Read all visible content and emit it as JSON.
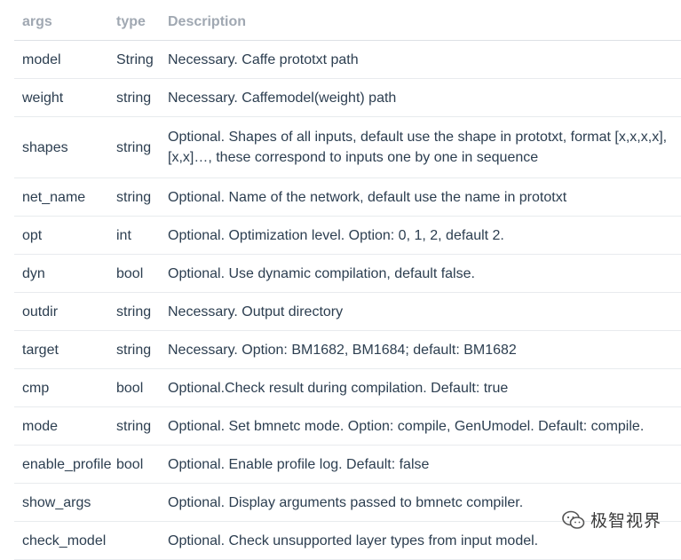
{
  "columns": {
    "args": "args",
    "type": "type",
    "description": "Description"
  },
  "rows": [
    {
      "args": "model",
      "type": "String",
      "description": "Necessary. Caffe prototxt path"
    },
    {
      "args": "weight",
      "type": "string",
      "description": "Necessary. Caffemodel(weight) path"
    },
    {
      "args": "shapes",
      "type": "string",
      "description": "Optional. Shapes of all inputs, default use the shape in prototxt, format [x,x,x,x],[x,x]…, these correspond to inputs one by one in sequence"
    },
    {
      "args": "net_name",
      "type": "string",
      "description": "Optional. Name of the network, default use the name in prototxt"
    },
    {
      "args": "opt",
      "type": "int",
      "description": "Optional. Optimization level. Option: 0, 1, 2, default 2."
    },
    {
      "args": "dyn",
      "type": "bool",
      "description": "Optional. Use dynamic compilation, default false."
    },
    {
      "args": "outdir",
      "type": "string",
      "description": "Necessary. Output directory"
    },
    {
      "args": "target",
      "type": "string",
      "description": "Necessary. Option: BM1682, BM1684; default: BM1682"
    },
    {
      "args": "cmp",
      "type": "bool",
      "description": "Optional.Check result during compilation. Default: true"
    },
    {
      "args": "mode",
      "type": "string",
      "description": "Optional. Set bmnetc mode. Option: compile, GenUmodel. Default: compile."
    },
    {
      "args": "enable_profile",
      "type": "bool",
      "description": "Optional. Enable profile log. Default: false"
    },
    {
      "args": "show_args",
      "type": "",
      "description": "Optional. Display arguments passed to bmnetc compiler."
    },
    {
      "args": "check_model",
      "type": "",
      "description": "Optional. Check unsupported layer types from input model."
    }
  ],
  "watermark": {
    "text": "极智视界",
    "icon": "wechat-icon"
  }
}
